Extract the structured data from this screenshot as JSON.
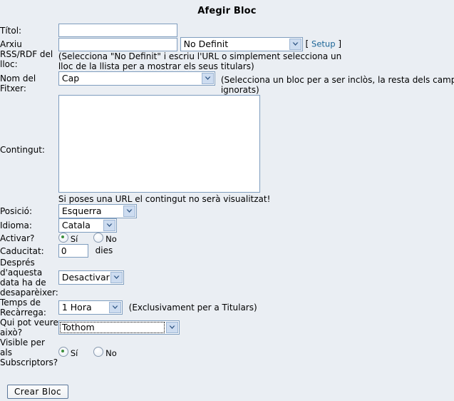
{
  "page": {
    "title": "Afegir Bloc",
    "background_color": "#eaeef3",
    "field_border_color": "#7f9dbe",
    "link_color": "#1a6496"
  },
  "fields": {
    "title": {
      "label": "Títol:",
      "value": "",
      "placeholder": ""
    },
    "rss": {
      "label": "Arxiu RSS/RDF del lloc:",
      "value": "",
      "placeholder": "",
      "select_value": "No Definit",
      "bracket_open": "[",
      "bracket_close": "]",
      "setup_link": "Setup",
      "hint": "(Selecciona \"No Definit\" i escriu l'URL o simplement selecciona un lloc de la llista per a mostrar els seus titulars)"
    },
    "filename": {
      "label": "Nom del Fitxer:",
      "select_value": "Cap",
      "hint": "(Selecciona un bloc per a ser inclòs, la resta dels camps seràn ignorats)"
    },
    "content": {
      "label": "Contingut:",
      "value": "",
      "hint": "Si poses una URL el contingut no serà visualitzat!"
    },
    "position": {
      "label": "Posició:",
      "select_value": "Esquerra"
    },
    "language": {
      "label": "Idioma:",
      "select_value": "Catala"
    },
    "activate": {
      "label": "Activar?",
      "options": [
        {
          "label": "Sí",
          "checked": true
        },
        {
          "label": "No",
          "checked": false
        }
      ]
    },
    "expiry": {
      "label": "Caducitat:",
      "value": "0",
      "unit": "dies"
    },
    "after_date": {
      "label": "Després d'aquesta data ha de desaparèixer:",
      "select_value": "Desactivar"
    },
    "reload_time": {
      "label": "Temps de Recàrrega:",
      "select_value": "1 Hora",
      "hint": "(Exclusivament per a Titulars)"
    },
    "visibility": {
      "label": "Qui pot veure això?",
      "select_value": "Tothom",
      "focused": true
    },
    "subscribers": {
      "label": "Visible per als Subscriptors?",
      "options": [
        {
          "label": "Sí",
          "checked": true
        },
        {
          "label": "No",
          "checked": false
        }
      ]
    }
  },
  "actions": {
    "submit_label": "Crear Bloc"
  },
  "icons": {
    "dropdown_arrow": "chevron-down-icon"
  }
}
